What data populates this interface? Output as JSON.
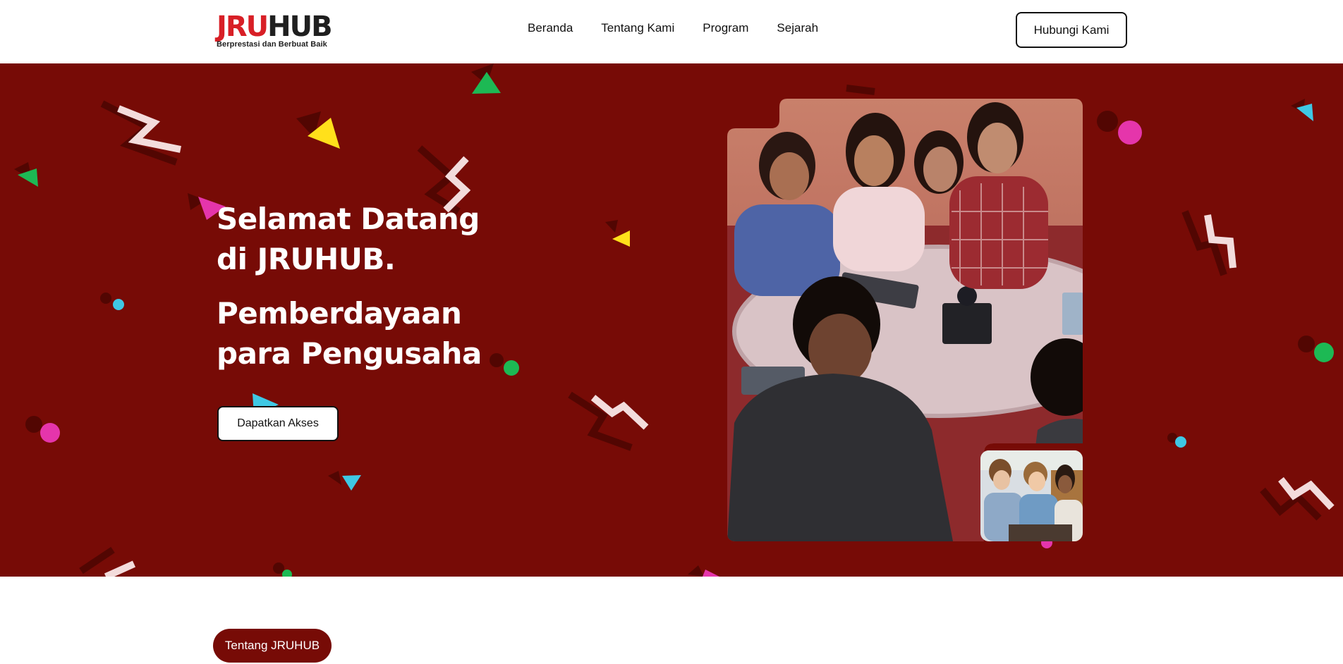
{
  "header": {
    "logo": {
      "brand_red": "JRU",
      "brand_dark": "HUB",
      "tagline": "Berprestasi dan Berbuat Baik"
    },
    "nav": [
      {
        "label": "Beranda"
      },
      {
        "label": "Tentang Kami"
      },
      {
        "label": "Program"
      },
      {
        "label": "Sejarah"
      }
    ],
    "contact_label": "Hubungi Kami"
  },
  "hero": {
    "title_line1": "Selamat Datang",
    "title_line2": "di JRUHUB.",
    "subtitle_line1": "Pemberdayaan",
    "subtitle_line2": "para Pengusaha",
    "cta_label": "Dapatkan Akses"
  },
  "section": {
    "pill_label": "Tentang JRUHUB"
  },
  "colors": {
    "hero_bg": "#770b06",
    "brand_red": "#d81f26",
    "confetti_green": "#1db954",
    "confetti_yellow": "#ffe01b",
    "confetti_pink": "#e535ab",
    "confetti_cyan": "#3fc8e4"
  }
}
